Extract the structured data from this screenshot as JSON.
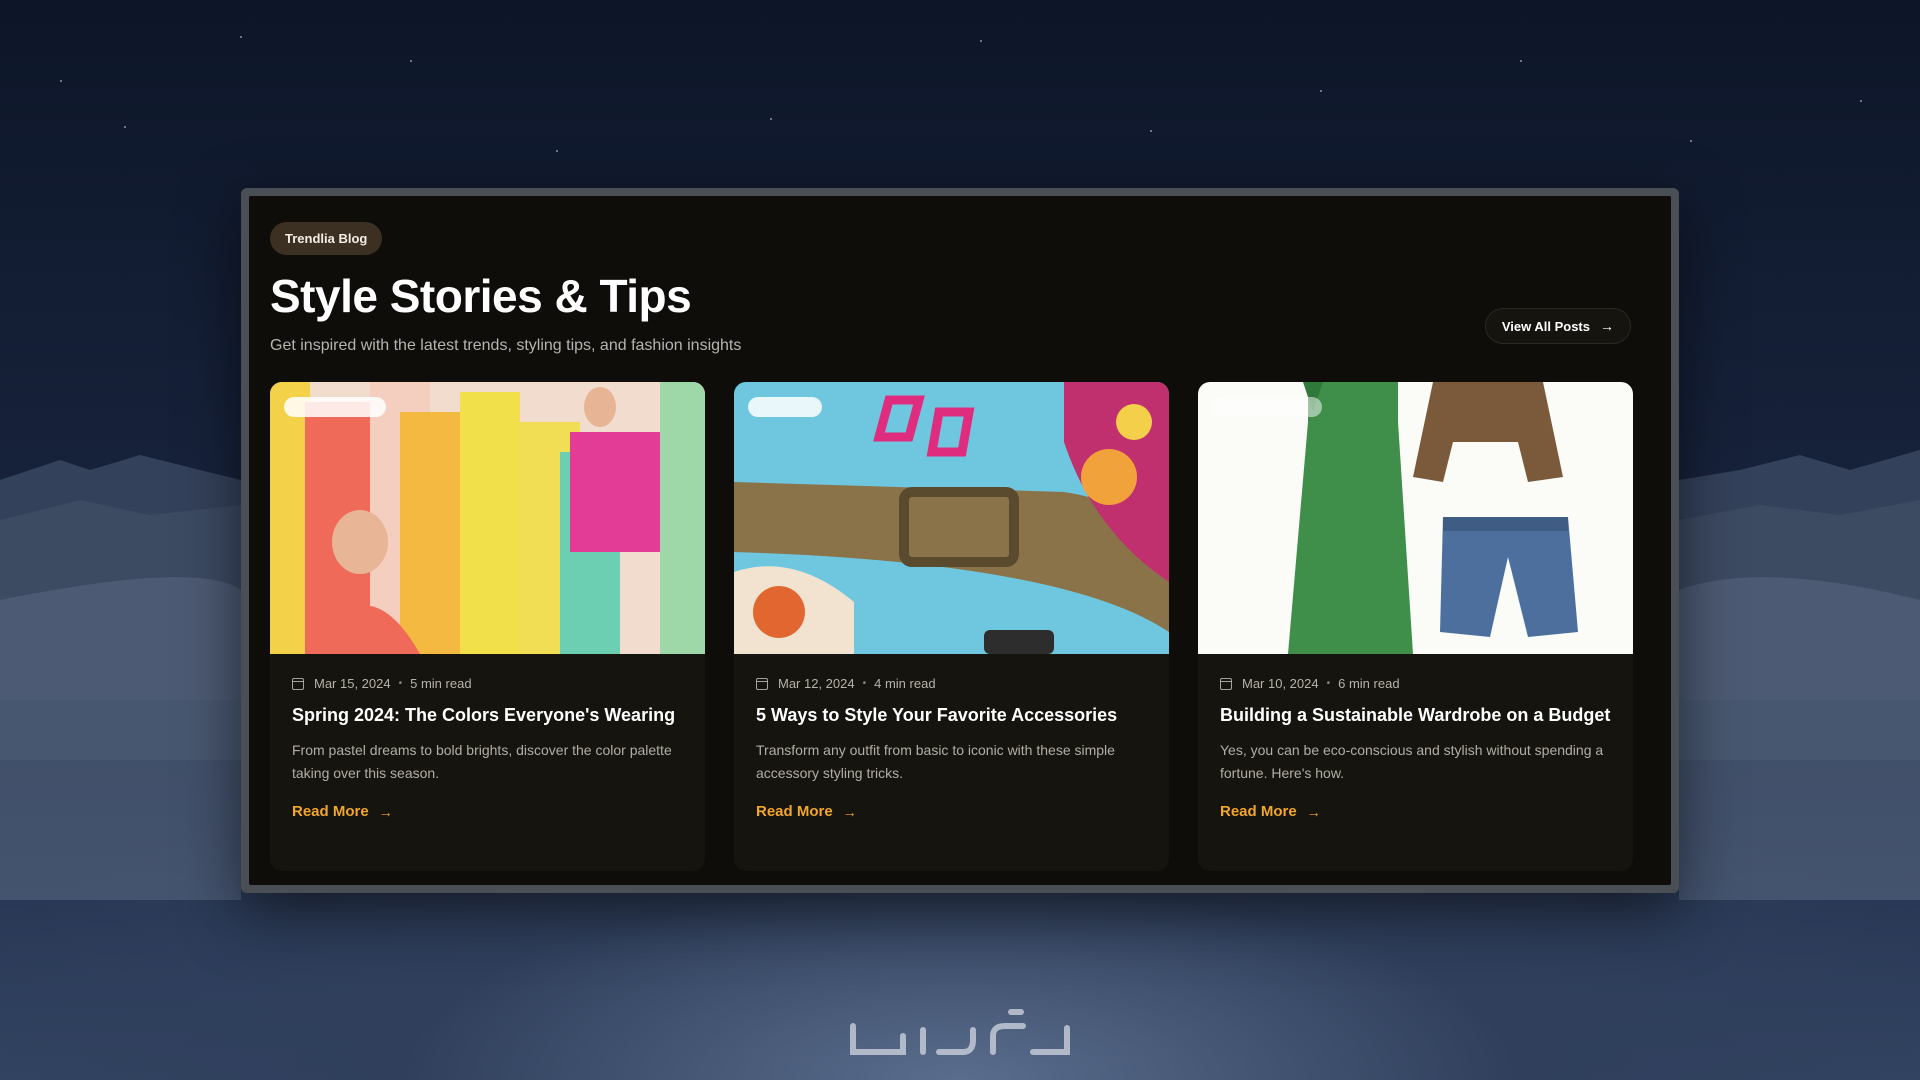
{
  "header": {
    "badge": "Trendlia Blog",
    "title": "Style Stories & Tips",
    "subtitle": "Get inspired with the latest trends, styling tips, and fashion insights",
    "view_all_label": "View All Posts"
  },
  "icons": {
    "arrow": "→",
    "calendar": "calendar-icon",
    "dot": "•"
  },
  "posts": [
    {
      "date": "Mar 15, 2024",
      "read_time": "5 min read",
      "title": "Spring 2024: The Colors Everyone's Wearing",
      "excerpt": "From pastel dreams to bold brights, discover the color palette taking over this season.",
      "cta": "Read More"
    },
    {
      "date": "Mar 12, 2024",
      "read_time": "4 min read",
      "title": "5 Ways to Style Your Favorite Accessories",
      "excerpt": "Transform any outfit from basic to iconic with these simple accessory styling tricks.",
      "cta": "Read More"
    },
    {
      "date": "Mar 10, 2024",
      "read_time": "6 min read",
      "title": "Building a Sustainable Wardrobe on a Budget",
      "excerpt": "Yes, you can be eco-conscious and stylish without spending a fortune. Here's how.",
      "cta": "Read More"
    }
  ],
  "colors": {
    "accent": "#f2a62b",
    "panel_bg": "#0e0d0a",
    "card_bg": "#15140f"
  }
}
